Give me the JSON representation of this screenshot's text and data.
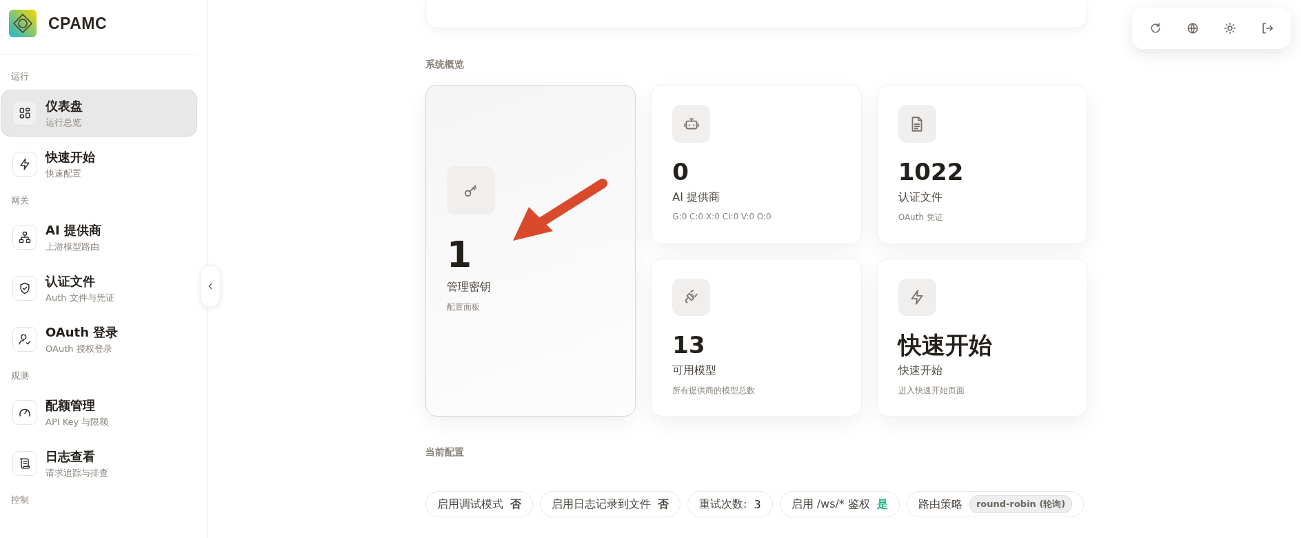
{
  "sidebar": {
    "logo_text": "CPAMC",
    "sections": [
      {
        "label": "运行",
        "items": [
          {
            "title": "仪表盘",
            "subtitle": "运行总览",
            "selected": true
          },
          {
            "title": "快速开始",
            "subtitle": "快速配置",
            "selected": false
          }
        ]
      },
      {
        "label": "网关",
        "items": [
          {
            "title": "AI 提供商",
            "subtitle": "上游模型路由",
            "selected": false
          },
          {
            "title": "认证文件",
            "subtitle": "Auth 文件与凭证",
            "selected": false
          },
          {
            "title": "OAuth 登录",
            "subtitle": "OAuth 授权登录",
            "selected": false
          }
        ]
      },
      {
        "label": "观测",
        "items": [
          {
            "title": "配额管理",
            "subtitle": "API Key 与限额",
            "selected": false
          },
          {
            "title": "日志查看",
            "subtitle": "请求追踪与排查",
            "selected": false
          }
        ]
      },
      {
        "label": "控制"
      }
    ]
  },
  "overview": {
    "title": "系统概览",
    "cards": [
      {
        "value": "1",
        "label": "管理密钥",
        "note": "配置面板",
        "selected": true
      },
      {
        "value": "0",
        "label": "AI 提供商",
        "note": "G:0 C:0 X:0 CI:0 V:0 O:0",
        "selected": false
      },
      {
        "value": "1022",
        "label": "认证文件",
        "note": "OAuth 凭证",
        "selected": false
      },
      {
        "value": "13",
        "label": "可用模型",
        "note": "所有提供商的模型总数",
        "selected": false
      },
      {
        "value": "快速开始",
        "label": "快速开始",
        "note": "进入快速开始页面",
        "selected": false
      }
    ]
  },
  "config": {
    "title": "当前配置",
    "items": [
      {
        "kind": "bool",
        "label": "启用调试模式",
        "value": "否",
        "on": false
      },
      {
        "kind": "bool",
        "label": "启用日志记录到文件",
        "value": "否",
        "on": false
      },
      {
        "kind": "number",
        "label": "重试次数:",
        "value": "3"
      },
      {
        "kind": "bool",
        "label": "启用 /ws/* 鉴权",
        "value": "是",
        "on": true
      },
      {
        "kind": "tag",
        "label": "路由策略",
        "value": "round-robin (轮询)"
      }
    ]
  }
}
